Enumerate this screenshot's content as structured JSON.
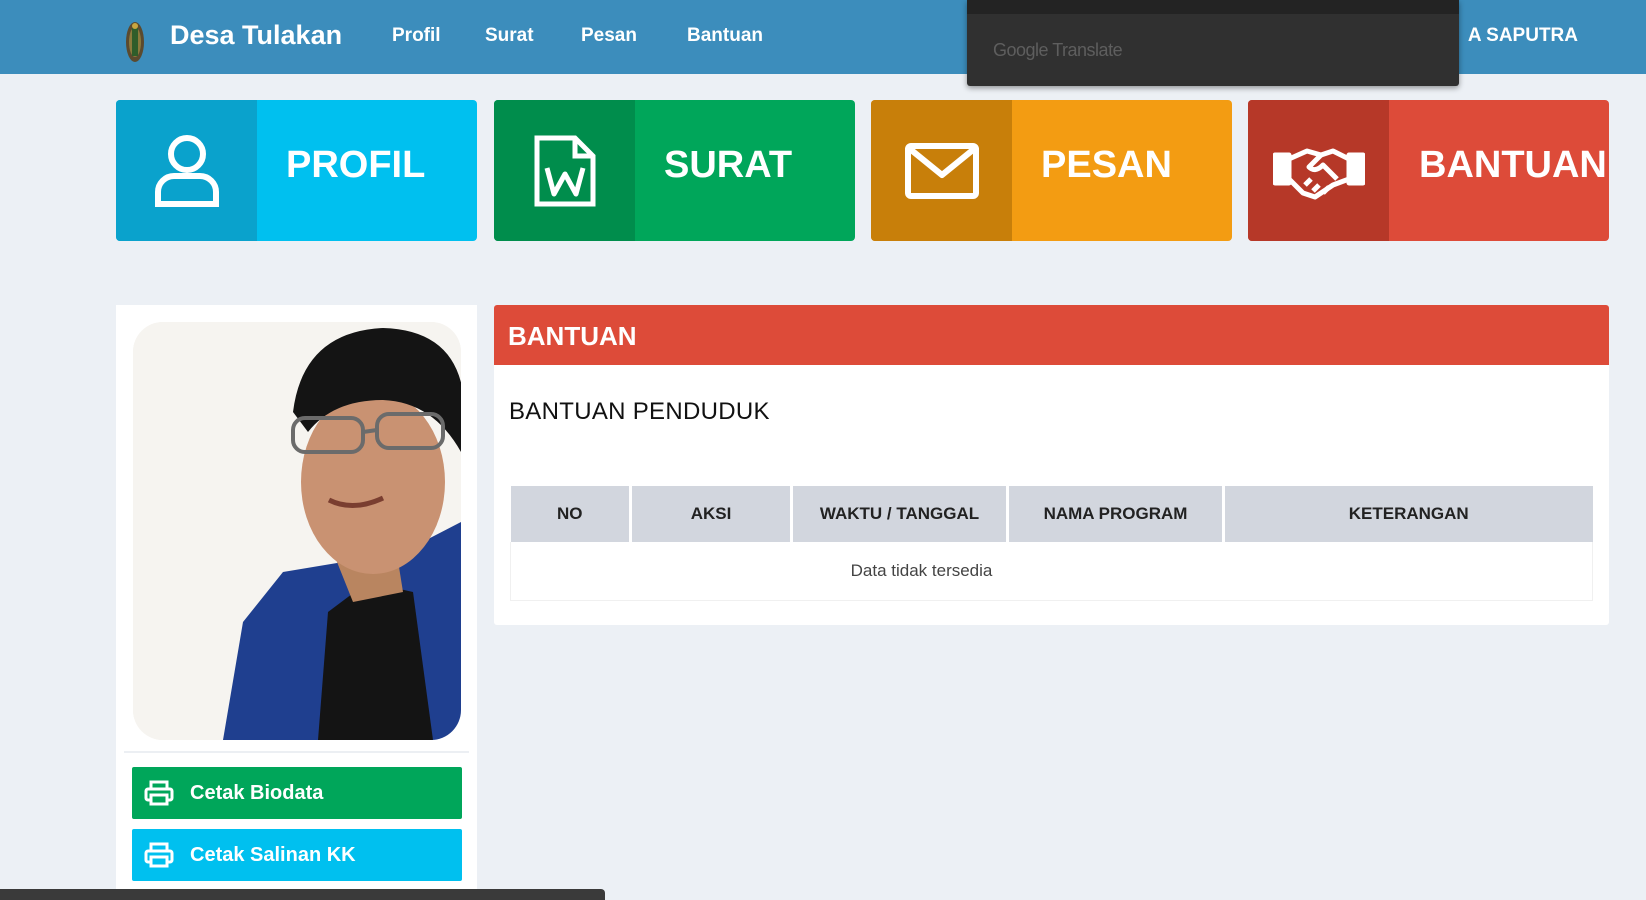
{
  "navbar": {
    "brand": "Desa Tulakan",
    "links": [
      "Profil",
      "Surat",
      "Pesan",
      "Bantuan"
    ],
    "user_name": "A SAPUTRA"
  },
  "translate_popup": {
    "label": "Google Translate"
  },
  "tiles": [
    {
      "label": "PROFIL",
      "icon": "user-icon",
      "color": "#00c0ef"
    },
    {
      "label": "SURAT",
      "icon": "word-document-icon",
      "color": "#00a65a"
    },
    {
      "label": "PESAN",
      "icon": "envelope-icon",
      "color": "#f39c12"
    },
    {
      "label": "BANTUAN",
      "icon": "handshake-icon",
      "color": "#dd4b39"
    }
  ],
  "profile": {
    "buttons": {
      "biodata": "Cetak Biodata",
      "kk": "Cetak Salinan KK"
    }
  },
  "panel": {
    "title": "BANTUAN",
    "subtitle": "BANTUAN PENDUDUK",
    "columns": [
      "NO",
      "AKSI",
      "WAKTU / TANGGAL",
      "NAMA PROGRAM",
      "KETERANGAN"
    ],
    "empty_message": "Data tidak tersedia"
  }
}
